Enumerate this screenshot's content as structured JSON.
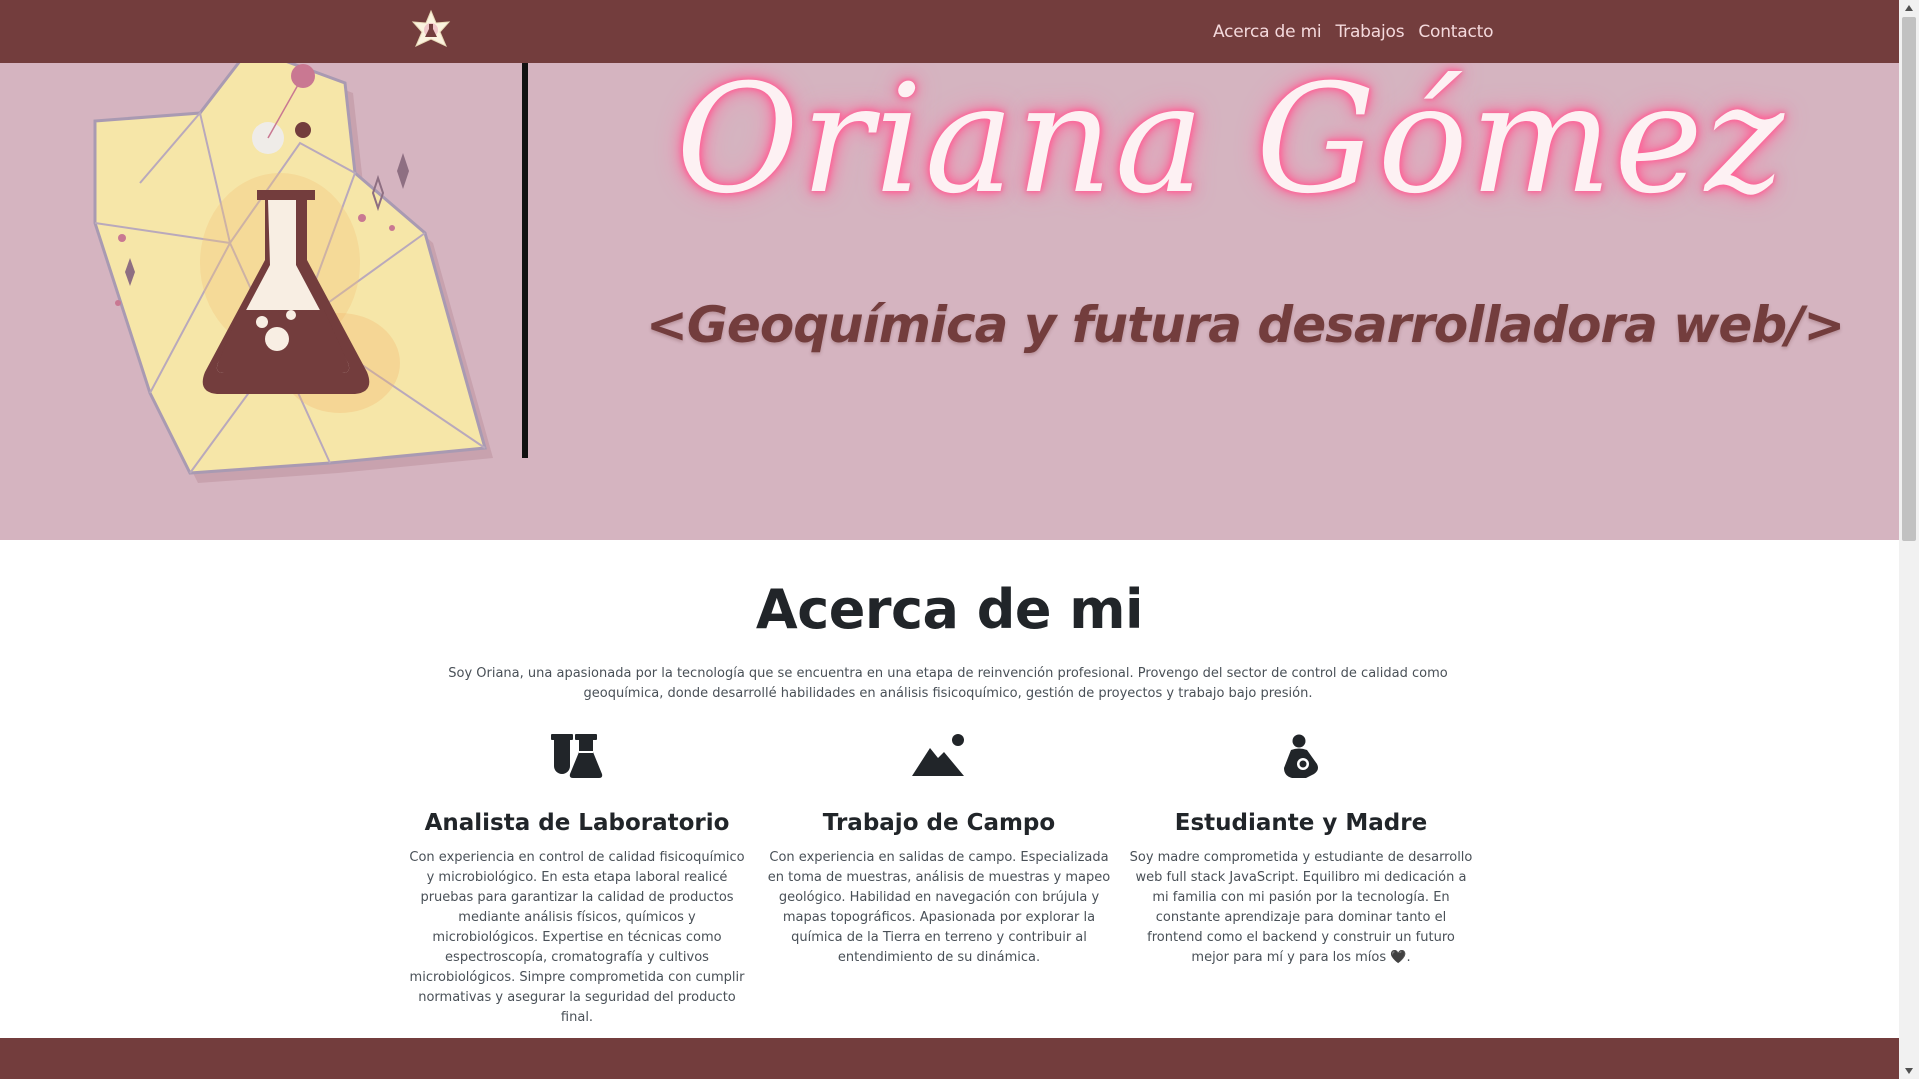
{
  "navbar": {
    "logo_icon": "flower-star-logo-icon",
    "links": [
      {
        "label": "Acerca de mi"
      },
      {
        "label": "Trabajos"
      },
      {
        "label": "Contacto"
      }
    ],
    "background": "#733d3d",
    "link_color": "#f4d9dc"
  },
  "hero": {
    "name": "Oriana Gómez",
    "subtitle": "<Geoquímica y futura desarrolladora web/>",
    "illustration_icon": "flask-crystal-icon",
    "background": "#d5b4c0"
  },
  "about": {
    "title": "Acerca de mi",
    "intro": "Soy Oriana, una apasionada por la tecnología que se encuentra en una etapa de reinvención profesional. Provengo del sector de control de calidad como geoquímica, donde desarrollé habilidades en análisis fisicoquímico, gestión de proyectos y trabajo bajo presión.",
    "cards": [
      {
        "icon": "flask-vial-icon",
        "title": "Analista de Laboratorio",
        "text": "Con experiencia en control de calidad fisicoquímico y microbiológico. En esta etapa laboral realicé pruebas para garantizar la calidad de productos mediante análisis físicos, químicos y microbiológicos. Expertise en técnicas como espectroscopía, cromatografía y cultivos microbiológicos. Simpre comprometida con cumplir normativas y asegurar la seguridad del producto final."
      },
      {
        "icon": "mountain-sun-icon",
        "title": "Trabajo de Campo",
        "text": "Con experiencia en salidas de campo. Especializada en toma de muestras, análisis de muestras y mapeo geológico. Habilidad en navegación con brújula y mapas topográficos. Apasionada por explorar la química de la Tierra en terreno y contribuir al entendimiento de su dinámica."
      },
      {
        "icon": "person-breastfeeding-icon",
        "title": "Estudiante y Madre",
        "text": "Soy madre comprometida y estudiante de desarrollo web full stack JavaScript. Equilibro mi dedicación a mi familia con mi pasión por la tecnología. En constante aprendizaje para dominar tanto el frontend como el backend y construir un futuro mejor para mí y para los míos 🖤."
      }
    ]
  }
}
